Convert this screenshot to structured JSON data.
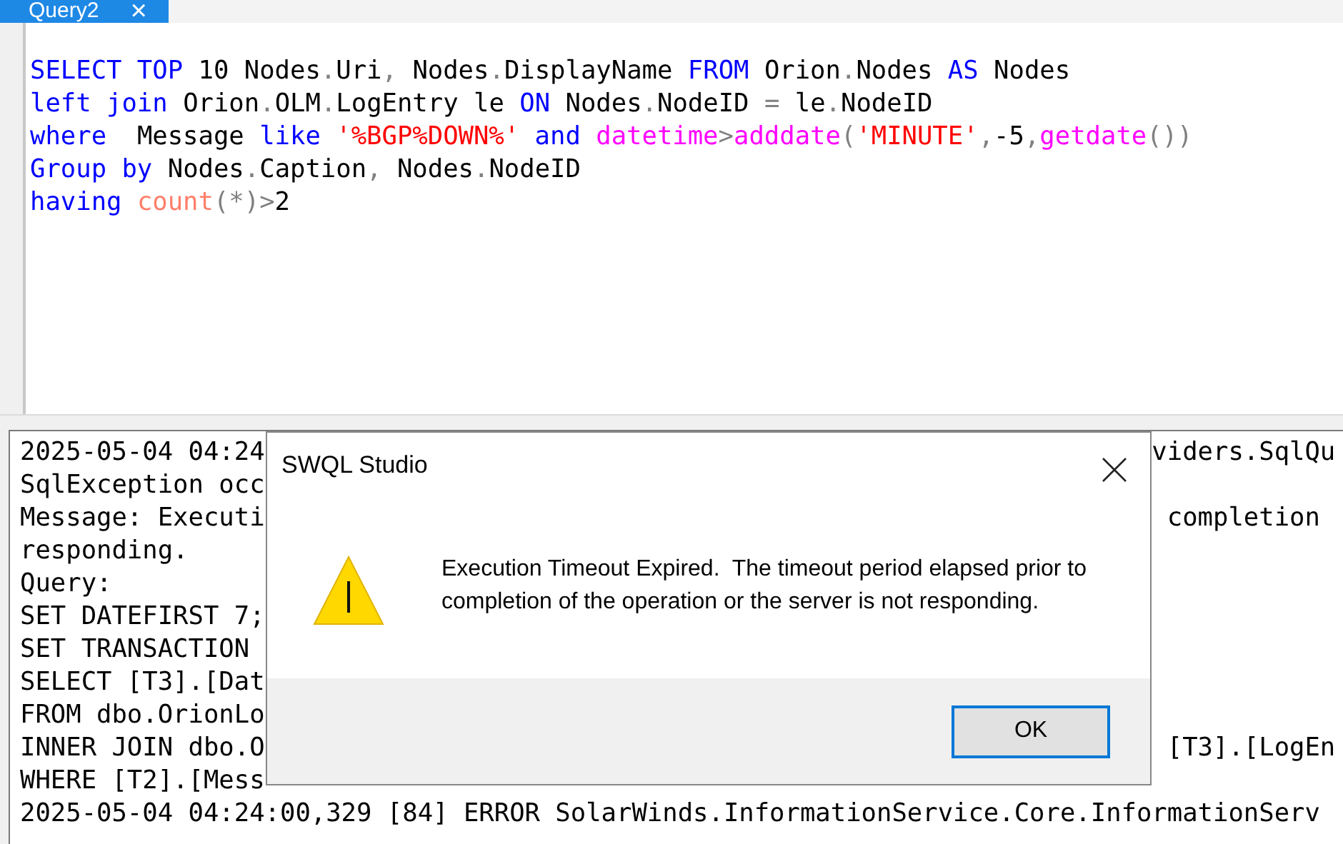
{
  "editor": {
    "tab": {
      "title": "Query2",
      "selected": true,
      "close": "×"
    },
    "lines": [
      [
        {
          "kind": "keyword",
          "text": "SELECT TOP"
        },
        {
          "kind": "text",
          "text": " 10 Nodes"
        },
        {
          "kind": "operator",
          "text": "."
        },
        {
          "kind": "text",
          "text": "Uri"
        },
        {
          "kind": "operator",
          "text": ","
        },
        {
          "kind": "text",
          "text": " Nodes"
        },
        {
          "kind": "operator",
          "text": "."
        },
        {
          "kind": "text",
          "text": "DisplayName "
        },
        {
          "kind": "keyword",
          "text": "FROM"
        },
        {
          "kind": "text",
          "text": " Orion"
        },
        {
          "kind": "operator",
          "text": "."
        },
        {
          "kind": "text",
          "text": "Nodes "
        },
        {
          "kind": "keyword",
          "text": "AS"
        },
        {
          "kind": "text",
          "text": " Nodes"
        }
      ],
      [
        {
          "kind": "keyword",
          "text": "left join"
        },
        {
          "kind": "text",
          "text": " Orion"
        },
        {
          "kind": "operator",
          "text": "."
        },
        {
          "kind": "text",
          "text": "OLM"
        },
        {
          "kind": "operator",
          "text": "."
        },
        {
          "kind": "text",
          "text": "LogEntry le "
        },
        {
          "kind": "keyword",
          "text": "ON"
        },
        {
          "kind": "text",
          "text": " Nodes"
        },
        {
          "kind": "operator",
          "text": "."
        },
        {
          "kind": "text",
          "text": "NodeID "
        },
        {
          "kind": "operator",
          "text": "="
        },
        {
          "kind": "text",
          "text": " le"
        },
        {
          "kind": "operator",
          "text": "."
        },
        {
          "kind": "text",
          "text": "NodeID"
        }
      ],
      [
        {
          "kind": "keyword",
          "text": "where"
        },
        {
          "kind": "text",
          "text": "  Message "
        },
        {
          "kind": "keyword",
          "text": "like"
        },
        {
          "kind": "string",
          "text": " '%BGP%DOWN%'"
        },
        {
          "kind": "keyword",
          "text": " and "
        },
        {
          "kind": "function",
          "text": "datetime"
        },
        {
          "kind": "operator",
          "text": ">"
        },
        {
          "kind": "function",
          "text": "adddate"
        },
        {
          "kind": "operator",
          "text": "("
        },
        {
          "kind": "string",
          "text": "'MINUTE'"
        },
        {
          "kind": "operator",
          "text": ","
        },
        {
          "kind": "text",
          "text": "-5"
        },
        {
          "kind": "operator",
          "text": ","
        },
        {
          "kind": "function",
          "text": "getdate"
        },
        {
          "kind": "operator",
          "text": "())"
        }
      ],
      [
        {
          "kind": "keyword",
          "text": "Group by"
        },
        {
          "kind": "text",
          "text": " Nodes"
        },
        {
          "kind": "operator",
          "text": "."
        },
        {
          "kind": "text",
          "text": "Caption"
        },
        {
          "kind": "operator",
          "text": ","
        },
        {
          "kind": "text",
          "text": " Nodes"
        },
        {
          "kind": "operator",
          "text": "."
        },
        {
          "kind": "text",
          "text": "NodeID"
        }
      ],
      [
        {
          "kind": "keyword",
          "text": "having "
        },
        {
          "kind": "aggregate",
          "text": "count"
        },
        {
          "kind": "operator",
          "text": "(*)>"
        },
        {
          "kind": "text",
          "text": "2"
        }
      ]
    ]
  },
  "log": {
    "lines": [
      {
        "left": "2025-05-04 04:24",
        "right": "viders.SqlQu"
      },
      {
        "left": "SqlException occ"
      },
      {
        "left": "Message: Executi",
        "right": " completion"
      },
      {
        "left": "responding."
      },
      {
        "left": "Query:"
      },
      {
        "left": "SET DATEFIRST 7;"
      },
      {
        "left": "SET TRANSACTION"
      },
      {
        "left": "SELECT [T3].[Dat"
      },
      {
        "left": "FROM dbo.OrionLo"
      },
      {
        "left": "INNER JOIN dbo.O",
        "right": " [T3].[LogEn"
      },
      {
        "left": "WHERE [T2].[Mess"
      },
      {
        "left": "2025-05-04 04:24:00,329 [84] ERROR SolarWinds.InformationService.Core.InformationServ"
      }
    ]
  },
  "dialog": {
    "title": "SWQL Studio",
    "message": "Execution Timeout Expired.  The timeout period elapsed prior to completion of the operation or the server is not responding.",
    "buttons": [
      {
        "label": "OK",
        "default": true
      }
    ]
  }
}
